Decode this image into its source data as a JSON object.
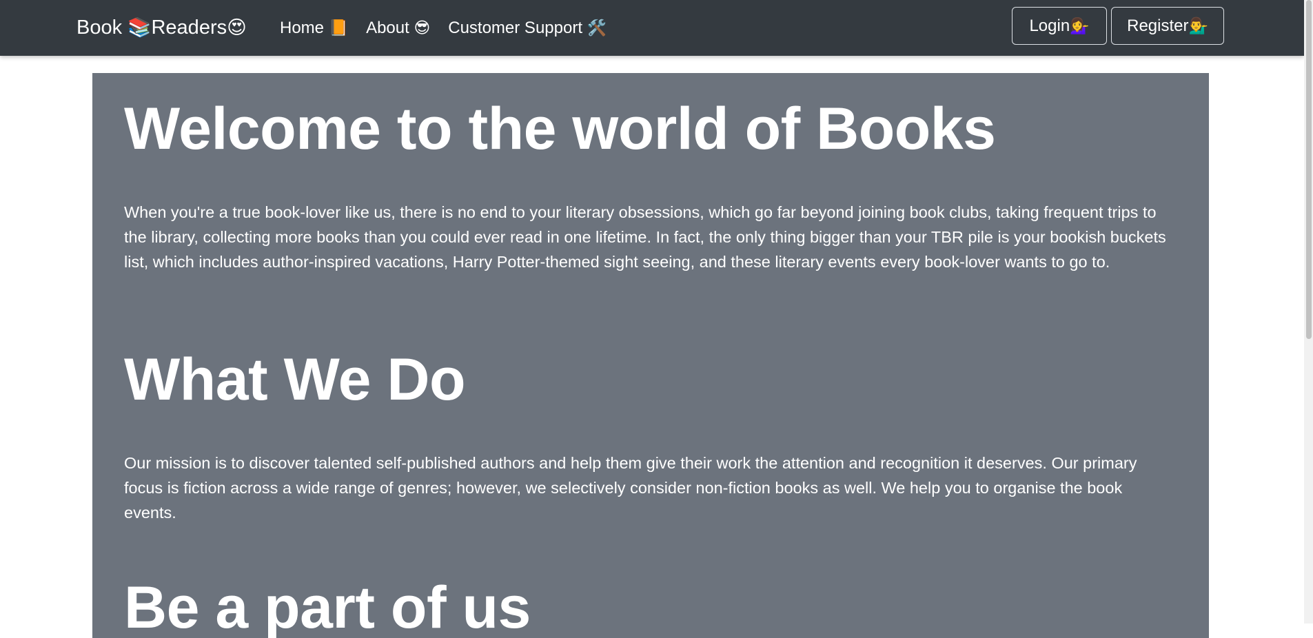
{
  "navbar": {
    "brand_part1": "Book ",
    "brand_emoji1": "📚",
    "brand_part2": "Readers",
    "brand_emoji2": "😍",
    "links": [
      {
        "label": "Home ",
        "emoji": "📙"
      },
      {
        "label": "About ",
        "emoji": "😎"
      },
      {
        "label": "Customer Support ",
        "emoji": "🛠️"
      }
    ],
    "login": {
      "label": "Login ",
      "emoji": "💁‍♀️"
    },
    "register": {
      "label": "Register ",
      "emoji": "💁‍♂️"
    }
  },
  "hero": {
    "welcome_heading": "Welcome to the world of Books",
    "intro_text": "When you're a true book-lover like us, there is no end to your literary obsessions, which go far beyond joining book clubs, taking frequent trips to the library, collecting more books than you could ever read in one lifetime. In fact, the only thing bigger than your TBR pile is your bookish buckets list, which includes author-inspired vacations, Harry Potter-themed sight seeing, and these literary events every book-lover wants to go to.",
    "what_heading": "What We Do",
    "mission_text": "Our mission is to discover talented self-published authors and help them give their work the attention and recognition it deserves. Our primary focus is fiction across a wide range of genres; however, we selectively consider non-fiction books as well. We help you to organise the book events.",
    "part_heading": "Be a part of us"
  },
  "colors": {
    "navbar_bg": "#343a40",
    "hero_bg": "#6c737d",
    "text": "#ffffff"
  }
}
